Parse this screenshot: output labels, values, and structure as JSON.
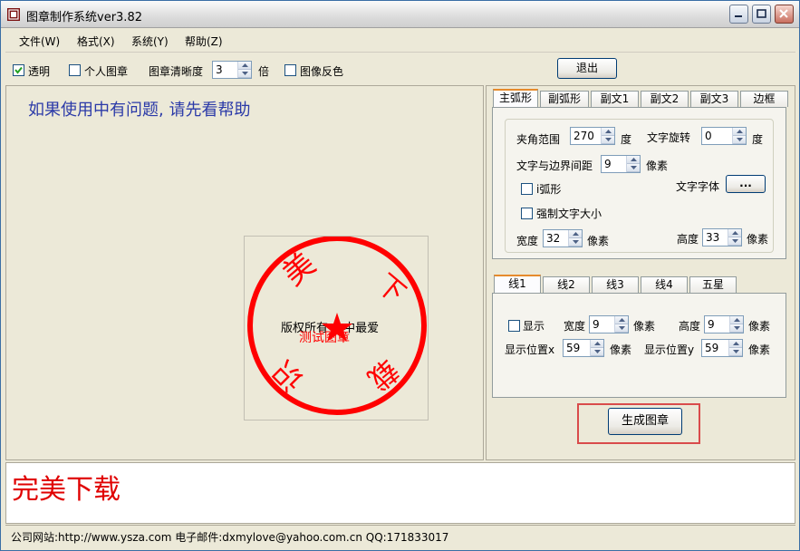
{
  "window": {
    "title": "图章制作系统ver3.82"
  },
  "menu": [
    "文件(W)",
    "格式(X)",
    "系统(Y)",
    "帮助(Z)"
  ],
  "toolbar": {
    "transparent_label": "透明",
    "transparent_checked": true,
    "personal_label": "个人图章",
    "personal_checked": false,
    "clarity_label": "图章清晰度",
    "clarity_value": "3",
    "clarity_unit": "倍",
    "invert_label": "图像反色",
    "invert_checked": false,
    "exit_label": "退出"
  },
  "canvas": {
    "hint": "如果使用中有问题, 请先看帮助",
    "stamp": {
      "color": "#ff0000",
      "outer_chars": [
        "美",
        "下",
        "识",
        "载"
      ],
      "center_text": "版权所有 生中最爱",
      "sub_text": "测试图章"
    }
  },
  "arc_tabs": [
    "主弧形",
    "副弧形",
    "副文1",
    "副文2",
    "副文3",
    "边框"
  ],
  "arc_panel": {
    "angle_label": "夹角范围",
    "angle_value": "270",
    "angle_unit": "度",
    "rotate_label": "文字旋转",
    "rotate_value": "0",
    "rotate_unit": "度",
    "spacing_label": "文字与边界间距",
    "spacing_value": "9",
    "spacing_unit": "像素",
    "arc_label": "i弧形",
    "force_label": "强制文字大小",
    "font_label": "文字字体",
    "font_button": "...",
    "width_label": "宽度",
    "width_value": "32",
    "width_unit": "像素",
    "height_label": "高度",
    "height_value": "33",
    "height_unit": "像素"
  },
  "line_tabs": [
    "线1",
    "线2",
    "线3",
    "线4",
    "五星"
  ],
  "line_panel": {
    "show_label": "显示",
    "width_label": "宽度",
    "width_value": "9",
    "width_unit": "像素",
    "height_label": "高度",
    "height_value": "9",
    "height_unit": "像素",
    "posx_label": "显示位置x",
    "posx_value": "59",
    "posx_unit": "像素",
    "posy_label": "显示位置y",
    "posy_value": "59",
    "posy_unit": "像素"
  },
  "generate_label": "生成图章",
  "brand_text": "完美下载",
  "status": "公司网站:http://www.ysza.com 电子邮件:dxmylove@yahoo.com.cn QQ:171833017"
}
